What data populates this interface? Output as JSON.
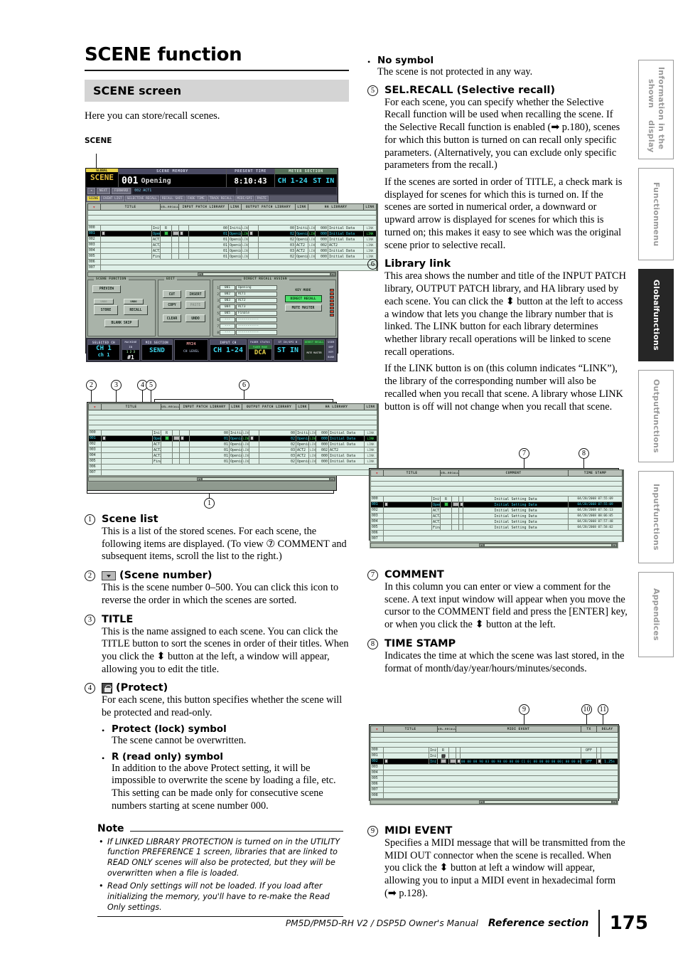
{
  "document": {
    "title": "SCENE function",
    "section_heading": "SCENE screen",
    "lead": "Here you can store/recall scenes.",
    "screen_caption": "SCENE"
  },
  "footer": {
    "manual": "PM5D/PM5D-RH V2 / DSP5D Owner's Manual",
    "section": "Reference section",
    "page": "175"
  },
  "edge_tabs": [
    {
      "line1": "Information shown",
      "line2": "in the display",
      "active": false
    },
    {
      "line1": "Function",
      "line2": "menu",
      "active": false
    },
    {
      "line1": "Global",
      "line2": "functions",
      "active": true
    },
    {
      "line1": "Output",
      "line2": "functions",
      "active": false
    },
    {
      "line1": "Input",
      "line2": "functions",
      "active": false
    },
    {
      "line1": "Appendices",
      "line2": "",
      "active": false
    }
  ],
  "left_column": {
    "items": [
      {
        "num": "1",
        "heading": "Scene list",
        "paras": [
          "This is a list of the stored scenes. For each scene, the following items are displayed. (To view ⑦ COMMENT and subsequent items, scroll the list to the right.)"
        ]
      },
      {
        "num": "2",
        "heading": "(Scene number)",
        "heading_icon": "sort-arrow-icon",
        "paras": [
          "This is the scene number 0–500. You can click this icon to reverse the order in which the scenes are sorted."
        ]
      },
      {
        "num": "3",
        "heading": "TITLE",
        "paras": [
          "This is the name assigned to each scene. You can click the TITLE button to sort the scenes in order of their titles. When you click the ⬍ button at the left, a window will appear, allowing you to edit the title."
        ]
      },
      {
        "num": "4",
        "heading": "(Protect)",
        "heading_icon": "lock-icon",
        "paras": [
          "For each scene, this button specifies whether the scene will be protected and read-only."
        ],
        "bullets": [
          {
            "label": "Protect (lock) symbol",
            "text": "The scene cannot be overwritten."
          },
          {
            "label": "R (read only) symbol",
            "text": "In addition to the above Protect setting, it will be impossible to overwrite the scene by loading a file, etc. This setting can be made only for consecutive scene numbers starting at scene number 000."
          }
        ]
      }
    ],
    "note": {
      "heading": "Note",
      "bullets": [
        "If LINKED LIBRARY PROTECTION is turned on in the UTILITY function PREFERENCE 1 screen, libraries that are linked to READ ONLY scenes will also be protected, but they will be overwritten when a file is loaded.",
        "Read Only settings will not be loaded. If you load after initializing the memory, you'll have to re-make the Read Only settings."
      ]
    }
  },
  "right_column": {
    "top_bullet": {
      "label": "No symbol",
      "text": "The scene is not protected in any way."
    },
    "items": [
      {
        "num": "5",
        "heading": "SEL.RECALL (Selective recall)",
        "paras": [
          "For each scene, you can specify whether the Selective Recall function will be used when recalling the scene. If the Selective Recall function is enabled (➡ p.180), scenes for which this button is turned on can recall only specific parameters. (Alternatively, you can exclude only specific parameters from the recall.)",
          "If the scenes are sorted in order of TITLE, a check mark is displayed for scenes for which this is turned on. If the scenes are sorted in numerical order, a downward or upward arrow is displayed for scenes for which this is turned on; this makes it easy to see which was the original scene prior to selective recall."
        ]
      },
      {
        "num": "6",
        "heading": "Library link",
        "paras": [
          "This area shows the number and title of the INPUT PATCH library, OUTPUT PATCH library, and HA library used by each scene. You can click the ⬍ button at the left to access a window that lets you change the library number that is linked. The LINK button for each library determines whether library recall operations will be linked to scene recall operations.",
          "If the LINK button is on (this column indicates “LINK”), the library of the corresponding number will also be recalled when you recall that scene. A library whose LINK button is off will not change when you recall that scene."
        ]
      },
      {
        "num": "7",
        "heading": "COMMENT",
        "paras": [
          "In this column you can enter or view a comment for the scene. A text input window will appear when you move the cursor to the COMMENT field and press the [ENTER] key, or when you click the ⬍ button at the left."
        ]
      },
      {
        "num": "8",
        "heading": "TIME STAMP",
        "paras": [
          "Indicates the time at which the scene was last stored, in the format of month/day/year/hours/minutes/seconds."
        ]
      },
      {
        "num": "9",
        "heading": "MIDI EVENT",
        "paras": [
          "Specifies a MIDI message that will be transmitted from the MIDI OUT connector when the scene is recalled. When you click the ⬍ button at left a window will appear, allowing you to input a MIDI event in hexadecimal form (➡ p.128)."
        ]
      }
    ]
  },
  "main_screen": {
    "global_label": "GLOBAL",
    "global_name": "SCENE",
    "blocks": [
      {
        "caption": "SCENE MEMORY",
        "number": "001",
        "name": "Opening"
      },
      {
        "caption": "PRESENT TIME",
        "value": "8:10:43"
      },
      {
        "caption": "METER SECTION",
        "values": [
          "CH 1-24",
          "ST IN"
        ]
      }
    ],
    "nav_buttons": [
      "NEXT",
      "FORWARD"
    ],
    "next_line": "002 ACT1",
    "tabs": [
      "SCENE",
      "EVENT LIST",
      "SELECTIVE RECALL",
      "RECALL SAFE",
      "FADE TIME",
      "TRACK RECALL",
      "MIDI/GPI",
      "PASTE"
    ],
    "active_tab": "SCENE",
    "columns": [
      "TITLE",
      "SEL.RECALL",
      "INPUT PATCH LIBRARY",
      "LINK",
      "OUTPUT PATCH LIBRARY",
      "LINK",
      "HA LIBRARY",
      "LINK"
    ],
    "rows": [
      {
        "no": "000",
        "title": "Initial Data",
        "protect": "R",
        "in_no": "00",
        "in_title": "Initial Data",
        "in_link": "LINK",
        "out_no": "00",
        "out_title": "Initial Data",
        "out_link": "LINK",
        "ha_no": "000",
        "ha_title": "Initial Data",
        "ha_link": "LINK",
        "selected": false
      },
      {
        "no": "001",
        "title": "Opening",
        "protect": "check",
        "in_no": "01",
        "in_title": "Opening",
        "in_link": "LINK",
        "out_no": "02",
        "out_title": "Opening",
        "out_link": "LINK",
        "ha_no": "000",
        "ha_title": "Initial Data",
        "ha_link": "LINK",
        "selected": true
      },
      {
        "no": "002",
        "title": "ACT1",
        "protect": "",
        "in_no": "01",
        "in_title": "Opening",
        "in_link": "LINK",
        "out_no": "02",
        "out_title": "Opening",
        "out_link": "LINK",
        "ha_no": "000",
        "ha_title": "Initial Data",
        "ha_link": "LINK",
        "selected": false
      },
      {
        "no": "003",
        "title": "ACT2",
        "protect": "",
        "in_no": "01",
        "in_title": "Opening",
        "in_link": "LINK",
        "out_no": "03",
        "out_title": "ACT2",
        "out_link": "LINK",
        "ha_no": "002",
        "ha_title": "ACT2",
        "ha_link": "LINK",
        "selected": false
      },
      {
        "no": "004",
        "title": "ACT3",
        "protect": "",
        "in_no": "01",
        "in_title": "Opening",
        "in_link": "LINK",
        "out_no": "03",
        "out_title": "ACT2",
        "out_link": "LINK",
        "ha_no": "000",
        "ha_title": "Initial Data",
        "ha_link": "LINK",
        "selected": false
      },
      {
        "no": "005",
        "title": "Finale",
        "protect": "",
        "in_no": "01",
        "in_title": "Opening",
        "in_link": "LINK",
        "out_no": "02",
        "out_title": "Opening",
        "out_link": "LINK",
        "ha_no": "000",
        "ha_title": "Initial Data",
        "ha_link": "LINK",
        "selected": false
      },
      {
        "no": "006",
        "title": "",
        "protect": "",
        "in_no": "",
        "in_title": "",
        "in_link": "",
        "out_no": "",
        "out_title": "",
        "out_link": "",
        "ha_no": "",
        "ha_title": "",
        "ha_link": "",
        "selected": false
      },
      {
        "no": "007",
        "title": "",
        "protect": "",
        "in_no": "",
        "in_title": "",
        "in_link": "",
        "out_no": "",
        "out_title": "",
        "out_link": "",
        "ha_no": "",
        "ha_title": "",
        "ha_link": "",
        "selected": false
      }
    ],
    "panels": {
      "scene_function": {
        "label": "SCENE FUNCTION",
        "preview": "PREVIEW",
        "undo_tag_left": "UNDO",
        "undo_tag_right": "UNDO",
        "store": "STORE",
        "recall": "RECALL",
        "blank_skip": "BLANK SKIP"
      },
      "edit": {
        "label": "EDIT",
        "buttons": [
          "CUT",
          "INSERT",
          "COPY",
          "PASTE",
          "CLEAR",
          "UNDO"
        ]
      },
      "direct_recall": {
        "label": "DIRECT RECALL ASSIGN",
        "key_mode_label": "KEY MODE",
        "key_modes": [
          "DIRECT RECALL",
          "MUTE MASTER"
        ],
        "rows": [
          {
            "idx": "1",
            "no": "001",
            "name": "Opening"
          },
          {
            "idx": "2",
            "no": "002",
            "name": "ACT1"
          },
          {
            "idx": "3",
            "no": "003",
            "name": "ACT2"
          },
          {
            "idx": "4",
            "no": "004",
            "name": "ACT3"
          },
          {
            "idx": "5",
            "no": "005",
            "name": "Finale"
          },
          {
            "idx": "6",
            "no": "---",
            "name": "-----------"
          },
          {
            "idx": "7",
            "no": "---",
            "name": "-----------"
          },
          {
            "idx": "8",
            "no": "---",
            "name": "-----------"
          }
        ]
      }
    },
    "footer_blocks": [
      {
        "caption": "SELECTED CH",
        "value": "CH 1",
        "value2": "ch 1"
      },
      {
        "caption": "MACHINE ID",
        "value": "#1",
        "value2": "1 2 3"
      },
      {
        "caption": "MIX SECTION",
        "value": "SEND",
        "value2": ""
      },
      {
        "caption": "",
        "value": "MY24",
        "value2": "CH LEVEL"
      },
      {
        "caption": "INPUT CH",
        "value": "CH 1-24",
        "value2": ""
      },
      {
        "caption": "FADER STATUS",
        "value": "DCA",
        "value2": "FADER MODE"
      },
      {
        "caption": "ST IN/GPI B",
        "value": "ST IN",
        "value2": ""
      },
      {
        "caption": "DIRECT RECALL",
        "value": "MUTE MASTER",
        "value2": ""
      },
      {
        "caption": "USER DEF KEY BANK",
        "value": "A",
        "value2": ""
      }
    ]
  },
  "list_callouts": {
    "numbers": [
      "2",
      "3",
      "4",
      "5",
      "6",
      "1"
    ],
    "columns": [
      "TITLE",
      "SEL.RECALL",
      "INPUT PATCH LIBRARY",
      "LINK",
      "OUTPUT PATCH LIBRARY",
      "LINK",
      "HA LIBRARY",
      "LINK"
    ]
  },
  "comment_screen": {
    "callouts": [
      "7",
      "8"
    ],
    "columns": [
      "TITLE",
      "SEL.RECALL",
      "COMMENT",
      "TIME STAMP"
    ],
    "rows": [
      {
        "no": "000",
        "title": "Initial Data",
        "protect": "R",
        "comment": "Initial Setting Data",
        "stamp": "04/28/2008 07:55:09",
        "selected": false
      },
      {
        "no": "001",
        "title": "Opening",
        "protect": "check",
        "comment": "Initial Setting Data",
        "stamp": "04/28/2008 07:55:09",
        "selected": true
      },
      {
        "no": "002",
        "title": "ACT1",
        "protect": "",
        "comment": "Initial Setting Data",
        "stamp": "04/28/2008 07:56:13",
        "selected": false
      },
      {
        "no": "003",
        "title": "ACT2",
        "protect": "",
        "comment": "Initial Setting Data",
        "stamp": "04/28/2008 08:06:05",
        "selected": false
      },
      {
        "no": "004",
        "title": "ACT3",
        "protect": "",
        "comment": "Initial Setting Data",
        "stamp": "04/28/2008 07:57:48",
        "selected": false
      },
      {
        "no": "005",
        "title": "Finale",
        "protect": "",
        "comment": "Initial Setting Data",
        "stamp": "04/28/2008 07:58:02",
        "selected": false
      },
      {
        "no": "006",
        "title": "",
        "protect": "",
        "comment": "",
        "stamp": "",
        "selected": false
      },
      {
        "no": "007",
        "title": "",
        "protect": "",
        "comment": "",
        "stamp": "",
        "selected": false
      }
    ]
  },
  "midi_screen": {
    "callouts": [
      "9",
      "10",
      "11"
    ],
    "columns": [
      "TITLE",
      "SEL.RECALL",
      "MIDI EVENT",
      "TX",
      "DELAY"
    ],
    "rows": [
      {
        "no": "000",
        "title": "Initial Data",
        "protect": "R",
        "event": "",
        "tx": "OFF",
        "delay": "",
        "selected": false
      },
      {
        "no": "001",
        "title": "Initial Data",
        "protect": "lock",
        "event": "",
        "tx": "",
        "delay": "",
        "selected": false
      },
      {
        "no": "002",
        "title": "Initial Data",
        "protect": "",
        "event": "00 00 00 90 03 00 90 00 00 00 C1 0| 00 00 00 00 00| 00 00 00",
        "tx": "OFF",
        "delay": "1.25s",
        "selected": true
      },
      {
        "no": "003",
        "title": "",
        "protect": "",
        "event": "",
        "tx": "",
        "delay": "",
        "selected": false
      },
      {
        "no": "004",
        "title": "",
        "protect": "",
        "event": "",
        "tx": "",
        "delay": "",
        "selected": false
      },
      {
        "no": "005",
        "title": "",
        "protect": "",
        "event": "",
        "tx": "",
        "delay": "",
        "selected": false
      },
      {
        "no": "006",
        "title": "",
        "protect": "",
        "event": "",
        "tx": "",
        "delay": "",
        "selected": false
      },
      {
        "no": "007",
        "title": "",
        "protect": "",
        "event": "",
        "tx": "",
        "delay": "",
        "selected": false
      },
      {
        "no": "008",
        "title": "",
        "protect": "",
        "event": "",
        "tx": "",
        "delay": "",
        "selected": false
      }
    ]
  }
}
